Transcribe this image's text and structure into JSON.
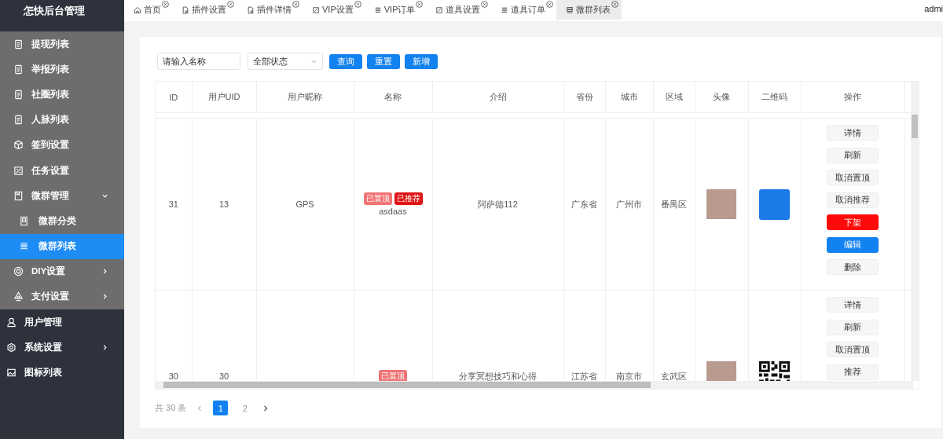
{
  "sidebar": {
    "title": "怎快后台管理",
    "submenu": [
      {
        "label": "提现列表",
        "selected": false
      },
      {
        "label": "举报列表",
        "selected": false
      },
      {
        "label": "社圈列表",
        "selected": false
      },
      {
        "label": "人脉列表",
        "selected": false
      },
      {
        "label": "签到设置",
        "selected": false
      },
      {
        "label": "任务设置",
        "selected": false
      },
      {
        "label": "微群管理",
        "expandable": true,
        "expanded": true,
        "selected": false,
        "children": [
          {
            "label": "微群分类",
            "selected": false
          },
          {
            "label": "微群列表",
            "selected": true
          }
        ]
      },
      {
        "label": "DIY设置",
        "expandable": true,
        "expanded": false,
        "selected": false
      },
      {
        "label": "支付设置",
        "expandable": true,
        "expanded": false,
        "selected": false
      }
    ],
    "items": [
      {
        "label": "用户管理",
        "selected": false
      },
      {
        "label": "系统设置",
        "expandable": true,
        "expanded": false,
        "selected": false
      },
      {
        "label": "图标列表",
        "selected": false
      }
    ]
  },
  "tabs": [
    {
      "label": "首页",
      "selected": false
    },
    {
      "label": "插件设置",
      "selected": false
    },
    {
      "label": "插件详情",
      "selected": false
    },
    {
      "label": "VIP设置",
      "selected": false
    },
    {
      "label": "VIP订单",
      "selected": false
    },
    {
      "label": "道具设置",
      "selected": false
    },
    {
      "label": "道具订单",
      "selected": false
    },
    {
      "label": "微群列表",
      "selected": true
    }
  ],
  "user": "admi",
  "filters": {
    "name_placeholder": "请输入名称",
    "status": "全部状态",
    "buttons": [
      "查询",
      "重置",
      "新增"
    ]
  },
  "table": {
    "columns": [
      "ID",
      "用户UID",
      "用户昵称",
      "名称",
      "介绍",
      "省份",
      "城市",
      "区域",
      "头像",
      "二维码",
      "操作"
    ],
    "rows": [
      {
        "id": "31",
        "uid": "13",
        "nickname": "GPS",
        "tags": [
          {
            "label": "已置顶",
            "color": "#f07474"
          },
          {
            "label": "已推荐",
            "color": "#e01515"
          }
        ],
        "name": "asdaas",
        "intro": "阿萨德112",
        "province": "广东省",
        "city": "广州市",
        "area": "番禺区",
        "qr": {
          "kind": "image"
        },
        "actions": [
          {
            "label": "详情",
            "kind": "default"
          },
          {
            "label": "刷新",
            "kind": "default"
          },
          {
            "label": "取消置顶",
            "kind": "default"
          },
          {
            "label": "取消推荐",
            "kind": "default"
          },
          {
            "label": "下架",
            "kind": "danger"
          },
          {
            "label": "编辑",
            "kind": "primary"
          },
          {
            "label": "删除",
            "kind": "default"
          }
        ]
      },
      {
        "id": "30",
        "uid": "30",
        "tags": [
          {
            "label": "已置顶",
            "color": "#f07474"
          }
        ],
        "intro": "分享冥想技巧和心得",
        "province": "江苏省",
        "city": "南京市",
        "area": "玄武区",
        "qr": {
          "kind": "code"
        },
        "actions": [
          {
            "label": "详情",
            "kind": "default"
          },
          {
            "label": "刷新",
            "kind": "default"
          },
          {
            "label": "取消置顶",
            "kind": "default"
          },
          {
            "label": "推荐",
            "kind": "default"
          }
        ]
      }
    ]
  },
  "pagination": {
    "total": "共 30 条",
    "pages": [
      {
        "label": "1",
        "selected": true
      },
      {
        "label": "2",
        "selected": false
      }
    ]
  }
}
